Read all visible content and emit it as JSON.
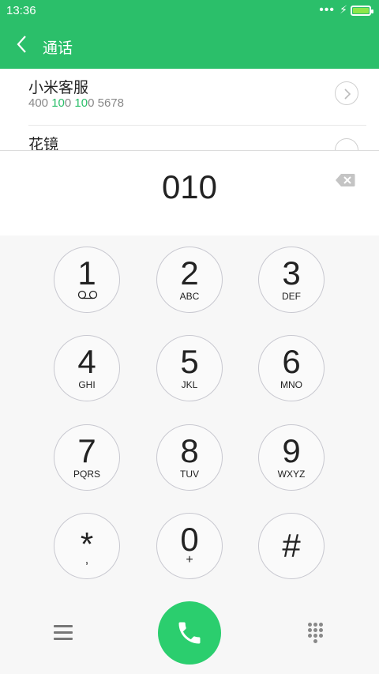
{
  "status_bar": {
    "time": "13:36",
    "signal_dots": "•••"
  },
  "app_bar": {
    "title": "通话",
    "back_icon": "chevron-left-icon"
  },
  "results": [
    {
      "name": "小米客服",
      "number_parts": [
        {
          "text": "400 ",
          "match": false
        },
        {
          "text": "10",
          "match": true
        },
        {
          "text": "0 ",
          "match": false
        },
        {
          "text": "10",
          "match": true
        },
        {
          "text": "0  5678",
          "match": false
        }
      ]
    },
    {
      "name": "花镜"
    }
  ],
  "dialer": {
    "typed_number": "010",
    "backspace_icon": "backspace-icon"
  },
  "keys": [
    {
      "digit": "1",
      "letters": ""
    },
    {
      "digit": "2",
      "letters": "ABC"
    },
    {
      "digit": "3",
      "letters": "DEF"
    },
    {
      "digit": "4",
      "letters": "GHI"
    },
    {
      "digit": "5",
      "letters": "JKL"
    },
    {
      "digit": "6",
      "letters": "MNO"
    },
    {
      "digit": "7",
      "letters": "PQRS"
    },
    {
      "digit": "8",
      "letters": "TUV"
    },
    {
      "digit": "9",
      "letters": "WXYZ"
    },
    {
      "digit": "*",
      "letters": ","
    },
    {
      "digit": "0",
      "letters": "+"
    },
    {
      "digit": "#",
      "letters": ""
    }
  ],
  "bottom_bar": {
    "menu_icon": "menu-icon",
    "call_icon": "phone-icon",
    "dialpad_icon": "dialpad-icon"
  },
  "colors": {
    "accent": "#2bbf6a",
    "call": "#2bce6e",
    "battery": "#8de64a"
  }
}
